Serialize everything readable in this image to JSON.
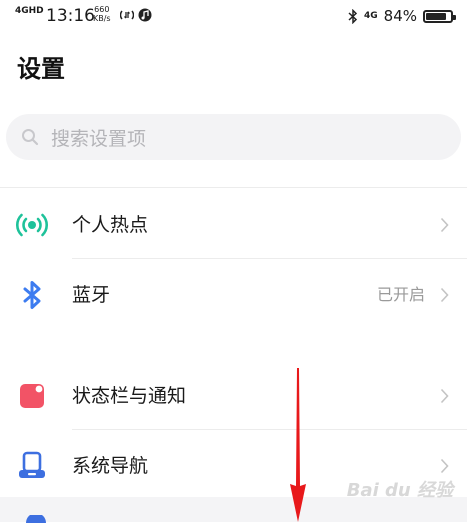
{
  "status_bar": {
    "network": "4GHD",
    "time": "13:16",
    "speed_value": "660",
    "speed_unit": "KB/s",
    "signal_right": "4G",
    "battery_percent": "84%",
    "battery_level": 0.84
  },
  "page": {
    "title": "设置"
  },
  "search": {
    "placeholder": "搜索设置项"
  },
  "items": [
    {
      "label": "个人热点",
      "value": "",
      "icon": "hotspot-icon"
    },
    {
      "label": "蓝牙",
      "value": "已开启",
      "icon": "bluetooth-icon"
    },
    {
      "label": "状态栏与通知",
      "value": "",
      "icon": "notification-icon"
    },
    {
      "label": "系统导航",
      "value": "",
      "icon": "navigation-icon"
    }
  ],
  "colors": {
    "hotspot": "#1ec29a",
    "bluetooth": "#3d7cf0",
    "notification": "#f25366",
    "navigation": "#3d6fe0",
    "arrow": "#e8191b"
  },
  "watermark": "Bai du 经验"
}
